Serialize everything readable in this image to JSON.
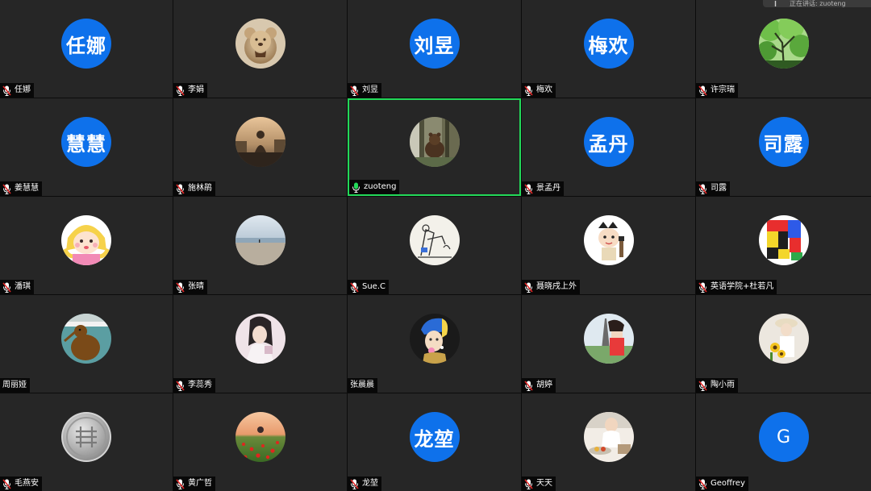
{
  "top_bar": {
    "label": "正在讲话: zuoteng"
  },
  "participants": [
    {
      "name": "任娜",
      "avatar_type": "initials",
      "initials": "任娜",
      "mic": "muted"
    },
    {
      "name": "李娟",
      "avatar_type": "photo",
      "photo": "teddy-bear",
      "mic": "muted"
    },
    {
      "name": "刘昱",
      "avatar_type": "initials",
      "initials": "刘昱",
      "mic": "muted"
    },
    {
      "name": "梅欢",
      "avatar_type": "initials",
      "initials": "梅欢",
      "mic": "muted"
    },
    {
      "name": "许宗瑞",
      "avatar_type": "photo",
      "photo": "green-tree",
      "mic": "muted"
    },
    {
      "name": "姜慧慧",
      "avatar_type": "initials",
      "initials": "慧慧",
      "mic": "muted"
    },
    {
      "name": "施林鹃",
      "avatar_type": "photo",
      "photo": "sunset-person",
      "mic": "muted"
    },
    {
      "name": "zuoteng",
      "avatar_type": "photo",
      "photo": "forest-bear",
      "mic": "speaking",
      "active": true
    },
    {
      "name": "景孟丹",
      "avatar_type": "initials",
      "initials": "孟丹",
      "mic": "muted"
    },
    {
      "name": "司露",
      "avatar_type": "initials",
      "initials": "司露",
      "mic": "muted"
    },
    {
      "name": "潘琪",
      "avatar_type": "photo",
      "photo": "cartoon-girl",
      "mic": "muted"
    },
    {
      "name": "张晴",
      "avatar_type": "photo",
      "photo": "beach",
      "mic": "muted"
    },
    {
      "name": "Sue.C",
      "avatar_type": "photo",
      "photo": "sketch",
      "mic": "muted"
    },
    {
      "name": "聂晓戌上外",
      "avatar_type": "photo",
      "photo": "cartoon-boy",
      "mic": "muted"
    },
    {
      "name": "英语学院+杜若凡",
      "avatar_type": "photo",
      "photo": "colorful-blocks",
      "mic": "muted"
    },
    {
      "name": "周丽娅",
      "avatar_type": "photo",
      "photo": "kiwi-bird",
      "mic": "none"
    },
    {
      "name": "李蕊秀",
      "avatar_type": "photo",
      "photo": "girl-portrait",
      "mic": "muted"
    },
    {
      "name": "张晨晨",
      "avatar_type": "photo",
      "photo": "pearl-earring",
      "mic": "none"
    },
    {
      "name": "胡婷",
      "avatar_type": "photo",
      "photo": "eiffel-tower",
      "mic": "muted"
    },
    {
      "name": "陶小雨",
      "avatar_type": "photo",
      "photo": "sunflowers",
      "mic": "muted"
    },
    {
      "name": "毛燕安",
      "avatar_type": "photo",
      "photo": "silver-coin",
      "mic": "muted"
    },
    {
      "name": "黄广哲",
      "avatar_type": "photo",
      "photo": "poppy-field",
      "mic": "muted"
    },
    {
      "name": "龙堃",
      "avatar_type": "initials",
      "initials": "龙堃",
      "mic": "muted"
    },
    {
      "name": "天天",
      "avatar_type": "photo",
      "photo": "cooking",
      "mic": "muted"
    },
    {
      "name": "Geoffrey",
      "avatar_type": "initials",
      "initials": "G",
      "mic": "muted"
    }
  ],
  "colors": {
    "tile_background": "#262626",
    "avatar_blue": "#0e71eb",
    "active_border": "#23d959",
    "muted_mic": "#e02828",
    "speaking_mic": "#23d959"
  }
}
